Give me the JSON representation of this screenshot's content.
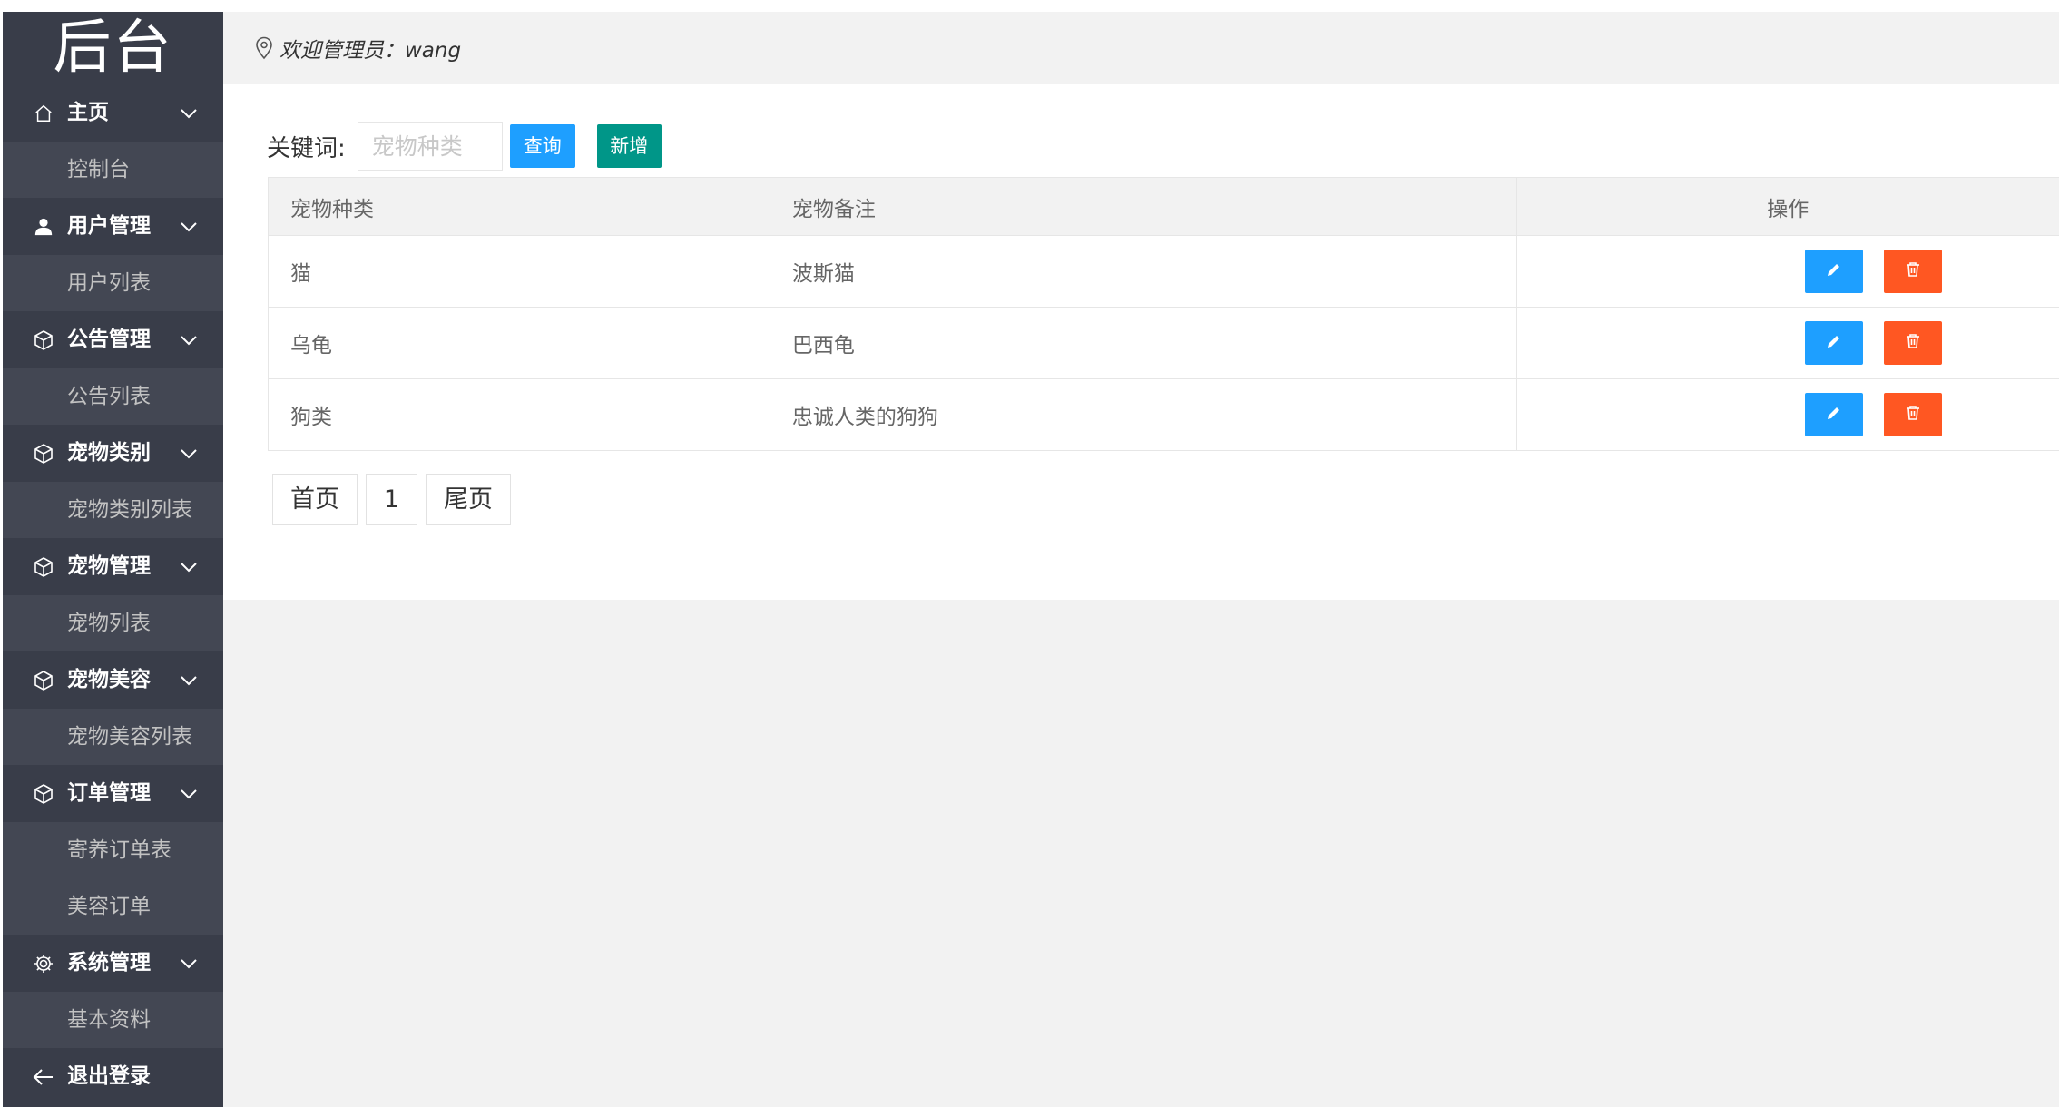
{
  "sidebar": {
    "logo": "后台",
    "groups": [
      {
        "label": "主页",
        "icon": "home-icon",
        "items": [
          "控制台"
        ]
      },
      {
        "label": "用户管理",
        "icon": "user-icon",
        "items": [
          "用户列表"
        ]
      },
      {
        "label": "公告管理",
        "icon": "cube-icon",
        "items": [
          "公告列表"
        ]
      },
      {
        "label": "宠物类别",
        "icon": "cube-icon",
        "items": [
          "宠物类别列表"
        ]
      },
      {
        "label": "宠物管理",
        "icon": "cube-icon",
        "items": [
          "宠物列表"
        ]
      },
      {
        "label": "宠物美容",
        "icon": "cube-icon",
        "items": [
          "宠物美容列表"
        ]
      },
      {
        "label": "订单管理",
        "icon": "cube-icon",
        "items": [
          "寄养订单表",
          "美容订单"
        ]
      },
      {
        "label": "系统管理",
        "icon": "gear-icon",
        "items": [
          "基本资料"
        ]
      }
    ],
    "logout": "退出登录"
  },
  "header": {
    "welcome": "欢迎管理员：wang"
  },
  "toolbar": {
    "keyword_label": "关键词:",
    "search_placeholder": "宠物种类",
    "query_label": "查询",
    "add_label": "新增"
  },
  "table": {
    "headers": [
      "宠物种类",
      "宠物备注",
      "操作"
    ],
    "rows": [
      [
        "猫",
        "波斯猫"
      ],
      [
        "乌龟",
        "巴西龟"
      ],
      [
        "狗类",
        "忠诚人类的狗狗"
      ]
    ]
  },
  "pagination": {
    "first": "首页",
    "current": "1",
    "last": "尾页"
  },
  "colors": {
    "sidebar_bg": "#393d49",
    "sidebar_sub_bg": "#434753",
    "primary_blue": "#1e9fff",
    "add_green": "#009688",
    "delete_orange": "#ff5722"
  }
}
